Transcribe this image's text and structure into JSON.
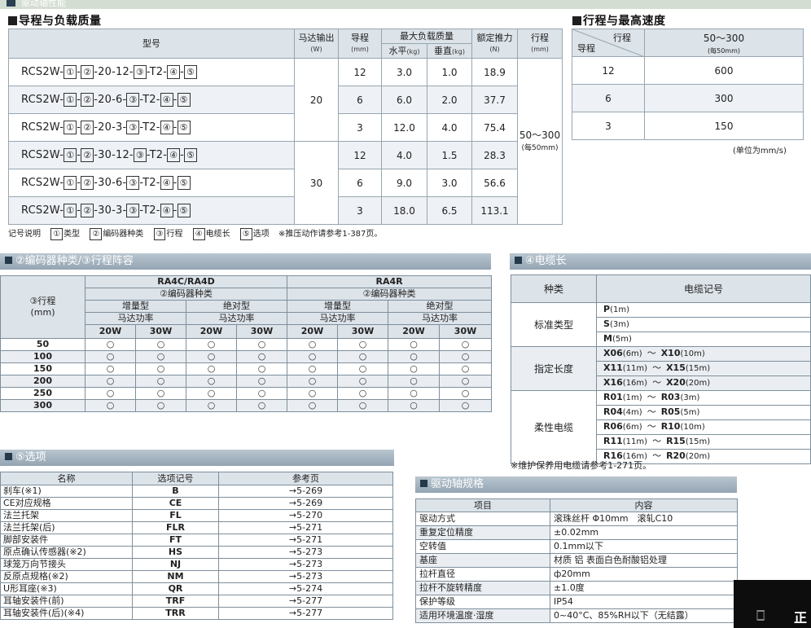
{
  "top_strip": "驱动轴性能",
  "sec1_title": "导程与负载质量",
  "sec2_title": "行程与最高速度",
  "t1": {
    "h_model": "型号",
    "h_motor": "马达输出",
    "h_motor_unit": "(W)",
    "h_lead": "导程",
    "h_lead_unit": "(mm)",
    "h_maxload": "最大负载质量",
    "h_horiz": "水平",
    "h_horiz_unit": "(kg)",
    "h_vert": "垂直",
    "h_vert_unit": "(kg)",
    "h_thrust": "额定推力",
    "h_thrust_unit": "(N)",
    "h_stroke": "行程",
    "h_stroke_unit": "(mm)",
    "rows": [
      {
        "pre": "RCS2W-",
        "b1": "①",
        "b2": "②",
        "mid": "-20-12-",
        "b3": "③",
        "t2": "-T2-",
        "b4": "④",
        "b5": "⑤",
        "lead": "12",
        "horiz": "3.0",
        "vert": "1.0",
        "thrust": "18.9"
      },
      {
        "pre": "RCS2W-",
        "b1": "①",
        "b2": "②",
        "mid": "-20-6-",
        "b3": "③",
        "t2": "-T2-",
        "b4": "④",
        "b5": "⑤",
        "lead": "6",
        "horiz": "6.0",
        "vert": "2.0",
        "thrust": "37.7"
      },
      {
        "pre": "RCS2W-",
        "b1": "①",
        "b2": "②",
        "mid": "-20-3-",
        "b3": "③",
        "t2": "-T2-",
        "b4": "④",
        "b5": "⑤",
        "lead": "3",
        "horiz": "12.0",
        "vert": "4.0",
        "thrust": "75.4"
      },
      {
        "pre": "RCS2W-",
        "b1": "①",
        "b2": "②",
        "mid": "-30-12-",
        "b3": "③",
        "t2": "-T2-",
        "b4": "④",
        "b5": "⑤",
        "lead": "12",
        "horiz": "4.0",
        "vert": "1.5",
        "thrust": "28.3"
      },
      {
        "pre": "RCS2W-",
        "b1": "①",
        "b2": "②",
        "mid": "-30-6-",
        "b3": "③",
        "t2": "-T2-",
        "b4": "④",
        "b5": "⑤",
        "lead": "6",
        "horiz": "9.0",
        "vert": "3.0",
        "thrust": "56.6"
      },
      {
        "pre": "RCS2W-",
        "b1": "①",
        "b2": "②",
        "mid": "-30-3-",
        "b3": "③",
        "t2": "-T2-",
        "b4": "④",
        "b5": "⑤",
        "lead": "3",
        "horiz": "18.0",
        "vert": "6.5",
        "thrust": "113.1"
      }
    ],
    "motor_a": "20",
    "motor_b": "30",
    "stroke_range": "50～300",
    "stroke_note": "(每50mm)"
  },
  "t2": {
    "diag_top": "行程",
    "diag_bottom": "导程",
    "stroke_range": "50～300",
    "stroke_note": "(每50mm)",
    "rows": [
      {
        "lead": "12",
        "speed": "600"
      },
      {
        "lead": "6",
        "speed": "300"
      },
      {
        "lead": "3",
        "speed": "150"
      }
    ],
    "unit_note": "(单位为mm/s)"
  },
  "legend": {
    "lead_text": "记号说明",
    "i1": "①",
    "t1": "类型",
    "i2": "②",
    "t2": "编码器种类",
    "i3": "③",
    "t3": "行程",
    "i4": "④",
    "t4": "电缆长",
    "i5": "⑤",
    "t5": "选项",
    "note": "※推压动作请参考1-387页。"
  },
  "banner_enc": "②编码器种类/③行程阵容",
  "banner_cable": "④电缆长",
  "banner_opt": "⑤选项",
  "banner_spec": "驱动轴规格",
  "t3": {
    "stroke_label": "③行程",
    "stroke_unit": "(mm)",
    "grp_a": "RA4C/RA4D",
    "grp_b": "RA4R",
    "enc_type": "②编码器种类",
    "inc": "增量型",
    "abs": "绝对型",
    "motor_power": "马达功率",
    "w20": "20W",
    "w30": "30W",
    "circle": "○",
    "strokes": [
      "50",
      "100",
      "150",
      "200",
      "250",
      "300"
    ]
  },
  "t4": {
    "h_kind": "种类",
    "h_code": "电缆记号",
    "standard": "标准类型",
    "specified": "指定长度",
    "robot": "柔性电缆",
    "std_rows": [
      {
        "code": "P",
        "len": "(1m)"
      },
      {
        "code": "S",
        "len": "(3m)"
      },
      {
        "code": "M",
        "len": "(5m)"
      }
    ],
    "spec_rows": [
      {
        "a": "X06",
        "al": "(6m)",
        "b": "X10",
        "bl": "(10m)"
      },
      {
        "a": "X11",
        "al": "(11m)",
        "b": "X15",
        "bl": "(15m)"
      },
      {
        "a": "X16",
        "al": "(16m)",
        "b": "X20",
        "bl": "(20m)"
      }
    ],
    "robot_rows": [
      {
        "a": "R01",
        "al": "(1m)",
        "b": "R03",
        "bl": "(3m)"
      },
      {
        "a": "R04",
        "al": "(4m)",
        "b": "R05",
        "bl": "(5m)"
      },
      {
        "a": "R06",
        "al": "(6m)",
        "b": "R10",
        "bl": "(10m)"
      },
      {
        "a": "R11",
        "al": "(11m)",
        "b": "R15",
        "bl": "(15m)"
      },
      {
        "a": "R16",
        "al": "(16m)",
        "b": "R20",
        "bl": "(20m)"
      }
    ],
    "tilde": "～",
    "note": "※维护保养用电缆请参考1-271页。"
  },
  "t5": {
    "h_name": "名称",
    "h_code": "选项记号",
    "h_page": "参考页",
    "rows": [
      {
        "name": "刹车(※1)",
        "code": "B",
        "page": "→5-269"
      },
      {
        "name": "CE对应规格",
        "code": "CE",
        "page": "→5-269"
      },
      {
        "name": "法兰托架",
        "code": "FL",
        "page": "→5-270"
      },
      {
        "name": "法兰托架(后)",
        "code": "FLR",
        "page": "→5-271"
      },
      {
        "name": "脚部安装件",
        "code": "FT",
        "page": "→5-271"
      },
      {
        "name": "原点确认传感器(※2)",
        "code": "HS",
        "page": "→5-273"
      },
      {
        "name": "球笼万向节接头",
        "code": "NJ",
        "page": "→5-273"
      },
      {
        "name": "反原点规格(※2)",
        "code": "NM",
        "page": "→5-273"
      },
      {
        "name": "U形耳座(※3)",
        "code": "QR",
        "page": "→5-274"
      },
      {
        "name": "耳轴安装件(前)",
        "code": "TRF",
        "page": "→5-277"
      },
      {
        "name": "耳轴安装件(后)(※4)",
        "code": "TRR",
        "page": "→5-277"
      }
    ]
  },
  "t6": {
    "h_item": "项目",
    "h_content": "内容",
    "rows": [
      {
        "item": "驱动方式",
        "content": "滚珠丝杆 Φ10mm　滚轧C10"
      },
      {
        "item": "重复定位精度",
        "content": "±0.02mm"
      },
      {
        "item": "空转值",
        "content": "0.1mm以下"
      },
      {
        "item": "基座",
        "content": "材质 铝 表面白色耐酸铝处理"
      },
      {
        "item": "拉杆直径",
        "content": "ф20mm"
      },
      {
        "item": "拉杆不旋转精度",
        "content": "±1.0度"
      },
      {
        "item": "保护等级",
        "content": "IP54"
      },
      {
        "item": "适用环境温度·湿度",
        "content": "0~40°C、85%RH以下（无结露）"
      }
    ]
  },
  "corner": {
    "g1": "🀆",
    "g2": "正"
  }
}
